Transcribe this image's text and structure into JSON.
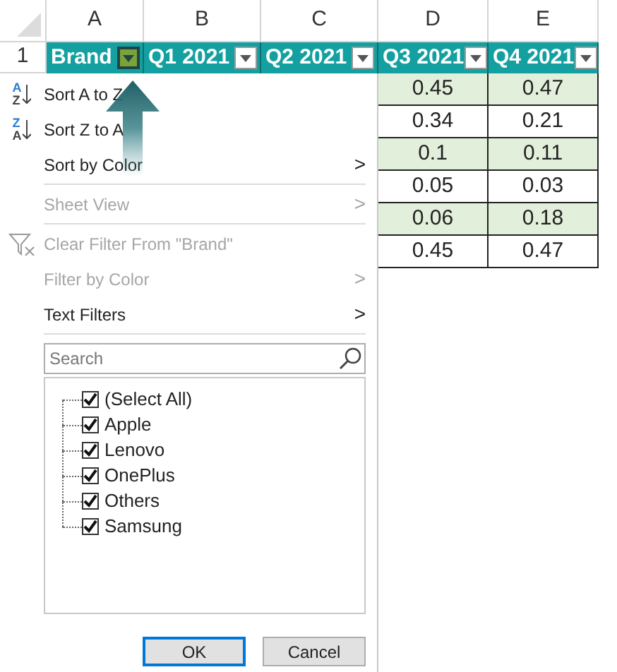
{
  "sheet": {
    "column_headers": [
      "A",
      "B",
      "C",
      "D",
      "E"
    ],
    "header_row_number": "1",
    "table_headers": [
      {
        "text": "Brand",
        "filter_selected": true
      },
      {
        "text": "Q1 2021",
        "filter_selected": false
      },
      {
        "text": "Q2 2021",
        "filter_selected": false
      },
      {
        "text": "Q3 2021",
        "filter_selected": false
      },
      {
        "text": "Q4 2021",
        "filter_selected": false
      }
    ],
    "rows": [
      [
        "0.45",
        "0.47"
      ],
      [
        "0.34",
        "0.21"
      ],
      [
        "0.1",
        "0.11"
      ],
      [
        "0.05",
        "0.03"
      ],
      [
        "0.06",
        "0.18"
      ],
      [
        "0.45",
        "0.47"
      ]
    ]
  },
  "filter_menu": {
    "items": [
      {
        "kind": "sort",
        "label": "Sort A to Z",
        "icon_letters": [
          "A",
          "Z"
        ],
        "disabled": false
      },
      {
        "kind": "sort",
        "label": "Sort Z to A",
        "icon_letters": [
          "Z",
          "A"
        ],
        "disabled": false
      },
      {
        "kind": "submenu",
        "label": "Sort by Color",
        "arrow": ">",
        "disabled": false
      },
      {
        "kind": "separator"
      },
      {
        "kind": "submenu",
        "label": "Sheet View",
        "arrow": ">",
        "disabled": true
      },
      {
        "kind": "separator"
      },
      {
        "kind": "clear",
        "label": "Clear Filter From \"Brand\"",
        "disabled": true
      },
      {
        "kind": "submenu",
        "label": "Filter by Color",
        "arrow": ">",
        "disabled": true
      },
      {
        "kind": "submenu",
        "label": "Text Filters",
        "arrow": ">",
        "disabled": false
      },
      {
        "kind": "separator"
      }
    ],
    "search": {
      "placeholder": "Search"
    },
    "values": [
      {
        "label": "(Select All)",
        "checked": true
      },
      {
        "label": "Apple",
        "checked": true
      },
      {
        "label": "Lenovo",
        "checked": true
      },
      {
        "label": "OnePlus",
        "checked": true
      },
      {
        "label": "Others",
        "checked": true
      },
      {
        "label": "Samsung",
        "checked": true
      }
    ],
    "buttons": [
      {
        "label": "OK",
        "default": true
      },
      {
        "label": "Cancel",
        "default": false
      }
    ]
  }
}
